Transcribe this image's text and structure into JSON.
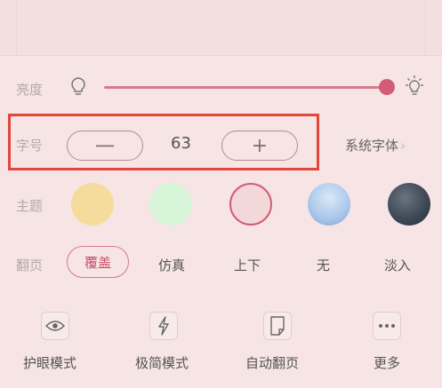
{
  "brightness": {
    "label": "亮度",
    "level": 0.96,
    "accent": "#d25c78"
  },
  "font_size": {
    "label": "字号",
    "decrease": "一",
    "increase": "+",
    "value": "63",
    "font_family": "系统字体",
    "chevron": "›"
  },
  "theme": {
    "label": "主题",
    "options": [
      {
        "name": "yellow",
        "color": "#f5dc9c"
      },
      {
        "name": "green",
        "color": "#d7f5d8"
      },
      {
        "name": "pink",
        "color": "#f3d8da",
        "selected": true
      },
      {
        "name": "blue-landscape",
        "color": "#a9c7ea"
      },
      {
        "name": "dark-landscape",
        "color": "#3c4654"
      }
    ]
  },
  "page_turn": {
    "label": "翻页",
    "options": [
      "覆盖",
      "仿真",
      "上下",
      "无",
      "淡入"
    ],
    "selected": "覆盖"
  },
  "tools": [
    {
      "label": "护眼模式",
      "icon": "eye-icon"
    },
    {
      "label": "极简模式",
      "icon": "lightning-icon"
    },
    {
      "label": "自动翻页",
      "icon": "page-icon"
    },
    {
      "label": "更多",
      "icon": "more-icon"
    }
  ]
}
